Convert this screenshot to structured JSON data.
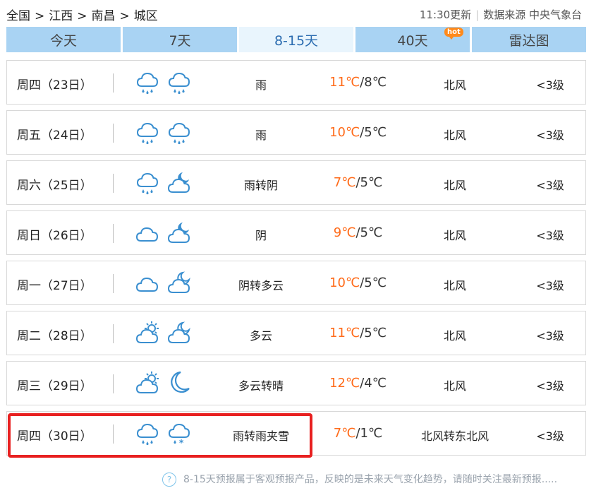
{
  "breadcrumb": [
    "全国",
    "江西",
    "南昌",
    "城区"
  ],
  "breadcrumb_sep": ">",
  "update": {
    "time": "11:30更新",
    "source": "数据来源 中央气象台"
  },
  "tabs": [
    {
      "label": "今天"
    },
    {
      "label": "7天"
    },
    {
      "label": "8-15天",
      "active": true
    },
    {
      "label": "40天",
      "badge": "hot"
    },
    {
      "label": "雷达图"
    }
  ],
  "forecast": [
    {
      "date": "周四（23日）",
      "icon_day": "rain-cloud-icon",
      "icon_night": "rain-cloud-icon",
      "condition": "雨",
      "high": "11℃",
      "low": "/8℃",
      "wind": "北风",
      "level": "<3级"
    },
    {
      "date": "周五（24日）",
      "icon_day": "rain-cloud-icon",
      "icon_night": "rain-cloud-icon",
      "condition": "雨",
      "high": "10℃",
      "low": "/5℃",
      "wind": "北风",
      "level": "<3级"
    },
    {
      "date": "周六（25日）",
      "icon_day": "rain-cloud-icon",
      "icon_night": "cloud-moon-icon",
      "condition": "雨转阴",
      "high": "7℃",
      "low": "/5℃",
      "wind": "北风",
      "level": "<3级"
    },
    {
      "date": "周日（26日）",
      "icon_day": "cloud-icon",
      "icon_night": "cloud-moon-icon",
      "condition": "阴",
      "high": "9℃",
      "low": "/5℃",
      "wind": "北风",
      "level": "<3级"
    },
    {
      "date": "周一（27日）",
      "icon_day": "cloud-icon",
      "icon_night": "partly-cloudy-night-icon",
      "condition": "阴转多云",
      "high": "10℃",
      "low": "/5℃",
      "wind": "北风",
      "level": "<3级"
    },
    {
      "date": "周二（28日）",
      "icon_day": "partly-cloudy-day-icon",
      "icon_night": "partly-cloudy-night-icon",
      "condition": "多云",
      "high": "11℃",
      "low": "/5℃",
      "wind": "北风",
      "level": "<3级"
    },
    {
      "date": "周三（29日）",
      "icon_day": "partly-cloudy-day-icon",
      "icon_night": "crescent-moon-icon",
      "condition": "多云转晴",
      "high": "12℃",
      "low": "/4℃",
      "wind": "北风",
      "level": "<3级"
    },
    {
      "date": "周四（30日）",
      "icon_day": "rain-cloud-icon",
      "icon_night": "sleet-cloud-icon",
      "condition": "雨转雨夹雪",
      "high": "7℃",
      "low": "/1℃",
      "wind": "北风转东北风",
      "level": "<3级"
    }
  ],
  "footnote": {
    "icon": "?",
    "text": "8-15天预报属于客观预报产品，反映的是未来天气变化趋势，请随时关注最新预报....."
  },
  "colors": {
    "tab_bg": "#a9d3f3",
    "tab_active_bg": "#e9f5fd",
    "high_temp": "#ff6b1a",
    "highlight": "#e82020",
    "icon": "#3a8fd0"
  }
}
